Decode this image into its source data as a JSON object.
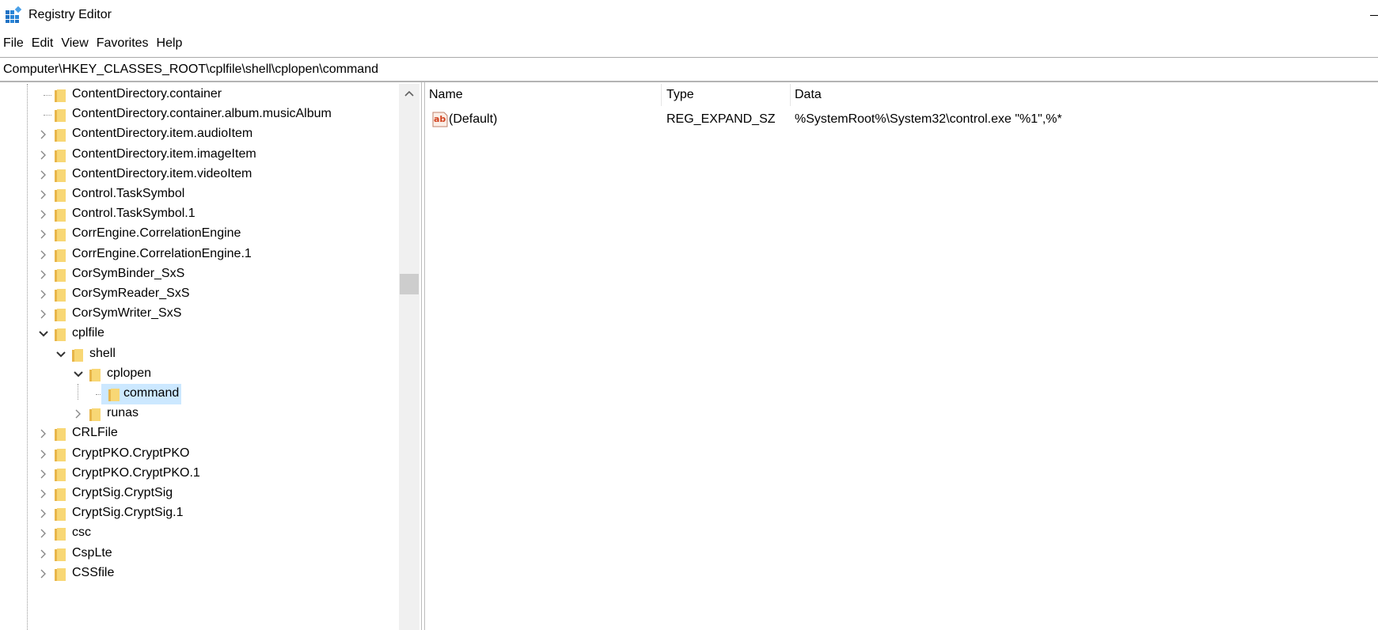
{
  "window": {
    "title": "Registry Editor"
  },
  "menu": [
    "File",
    "Edit",
    "View",
    "Favorites",
    "Help"
  ],
  "address": "Computer\\HKEY_CLASSES_ROOT\\cplfile\\shell\\cplopen\\command",
  "tree": [
    {
      "label": "ContentDirectory.container",
      "level": 1,
      "expander": "none"
    },
    {
      "label": "ContentDirectory.container.album.musicAlbum",
      "level": 1,
      "expander": "none"
    },
    {
      "label": "ContentDirectory.item.audioItem",
      "level": 1,
      "expander": "collapsed"
    },
    {
      "label": "ContentDirectory.item.imageItem",
      "level": 1,
      "expander": "collapsed"
    },
    {
      "label": "ContentDirectory.item.videoItem",
      "level": 1,
      "expander": "collapsed"
    },
    {
      "label": "Control.TaskSymbol",
      "level": 1,
      "expander": "collapsed"
    },
    {
      "label": "Control.TaskSymbol.1",
      "level": 1,
      "expander": "collapsed"
    },
    {
      "label": "CorrEngine.CorrelationEngine",
      "level": 1,
      "expander": "collapsed"
    },
    {
      "label": "CorrEngine.CorrelationEngine.1",
      "level": 1,
      "expander": "collapsed"
    },
    {
      "label": "CorSymBinder_SxS",
      "level": 1,
      "expander": "collapsed"
    },
    {
      "label": "CorSymReader_SxS",
      "level": 1,
      "expander": "collapsed"
    },
    {
      "label": "CorSymWriter_SxS",
      "level": 1,
      "expander": "collapsed"
    },
    {
      "label": "cplfile",
      "level": 1,
      "expander": "expanded"
    },
    {
      "label": "shell",
      "level": 2,
      "expander": "expanded"
    },
    {
      "label": "cplopen",
      "level": 3,
      "expander": "expanded"
    },
    {
      "label": "command",
      "level": 4,
      "expander": "none",
      "selected": true
    },
    {
      "label": "runas",
      "level": 3,
      "expander": "collapsed"
    },
    {
      "label": "CRLFile",
      "level": 1,
      "expander": "collapsed"
    },
    {
      "label": "CryptPKO.CryptPKO",
      "level": 1,
      "expander": "collapsed"
    },
    {
      "label": "CryptPKO.CryptPKO.1",
      "level": 1,
      "expander": "collapsed"
    },
    {
      "label": "CryptSig.CryptSig",
      "level": 1,
      "expander": "collapsed"
    },
    {
      "label": "CryptSig.CryptSig.1",
      "level": 1,
      "expander": "collapsed"
    },
    {
      "label": "csc",
      "level": 1,
      "expander": "collapsed"
    },
    {
      "label": "CspLte",
      "level": 1,
      "expander": "collapsed"
    },
    {
      "label": "CSSfile",
      "level": 1,
      "expander": "collapsed"
    }
  ],
  "list": {
    "columns": {
      "name": "Name",
      "type": "Type",
      "data": "Data"
    },
    "rows": [
      {
        "name": "(Default)",
        "type": "REG_EXPAND_SZ",
        "data": "%SystemRoot%\\System32\\control.exe \"%1\",%*",
        "icon": "string-value-icon"
      }
    ]
  },
  "colors": {
    "selection": "#cce8ff",
    "folder": "#f8d775",
    "folder_dark": "#e8b64a"
  }
}
